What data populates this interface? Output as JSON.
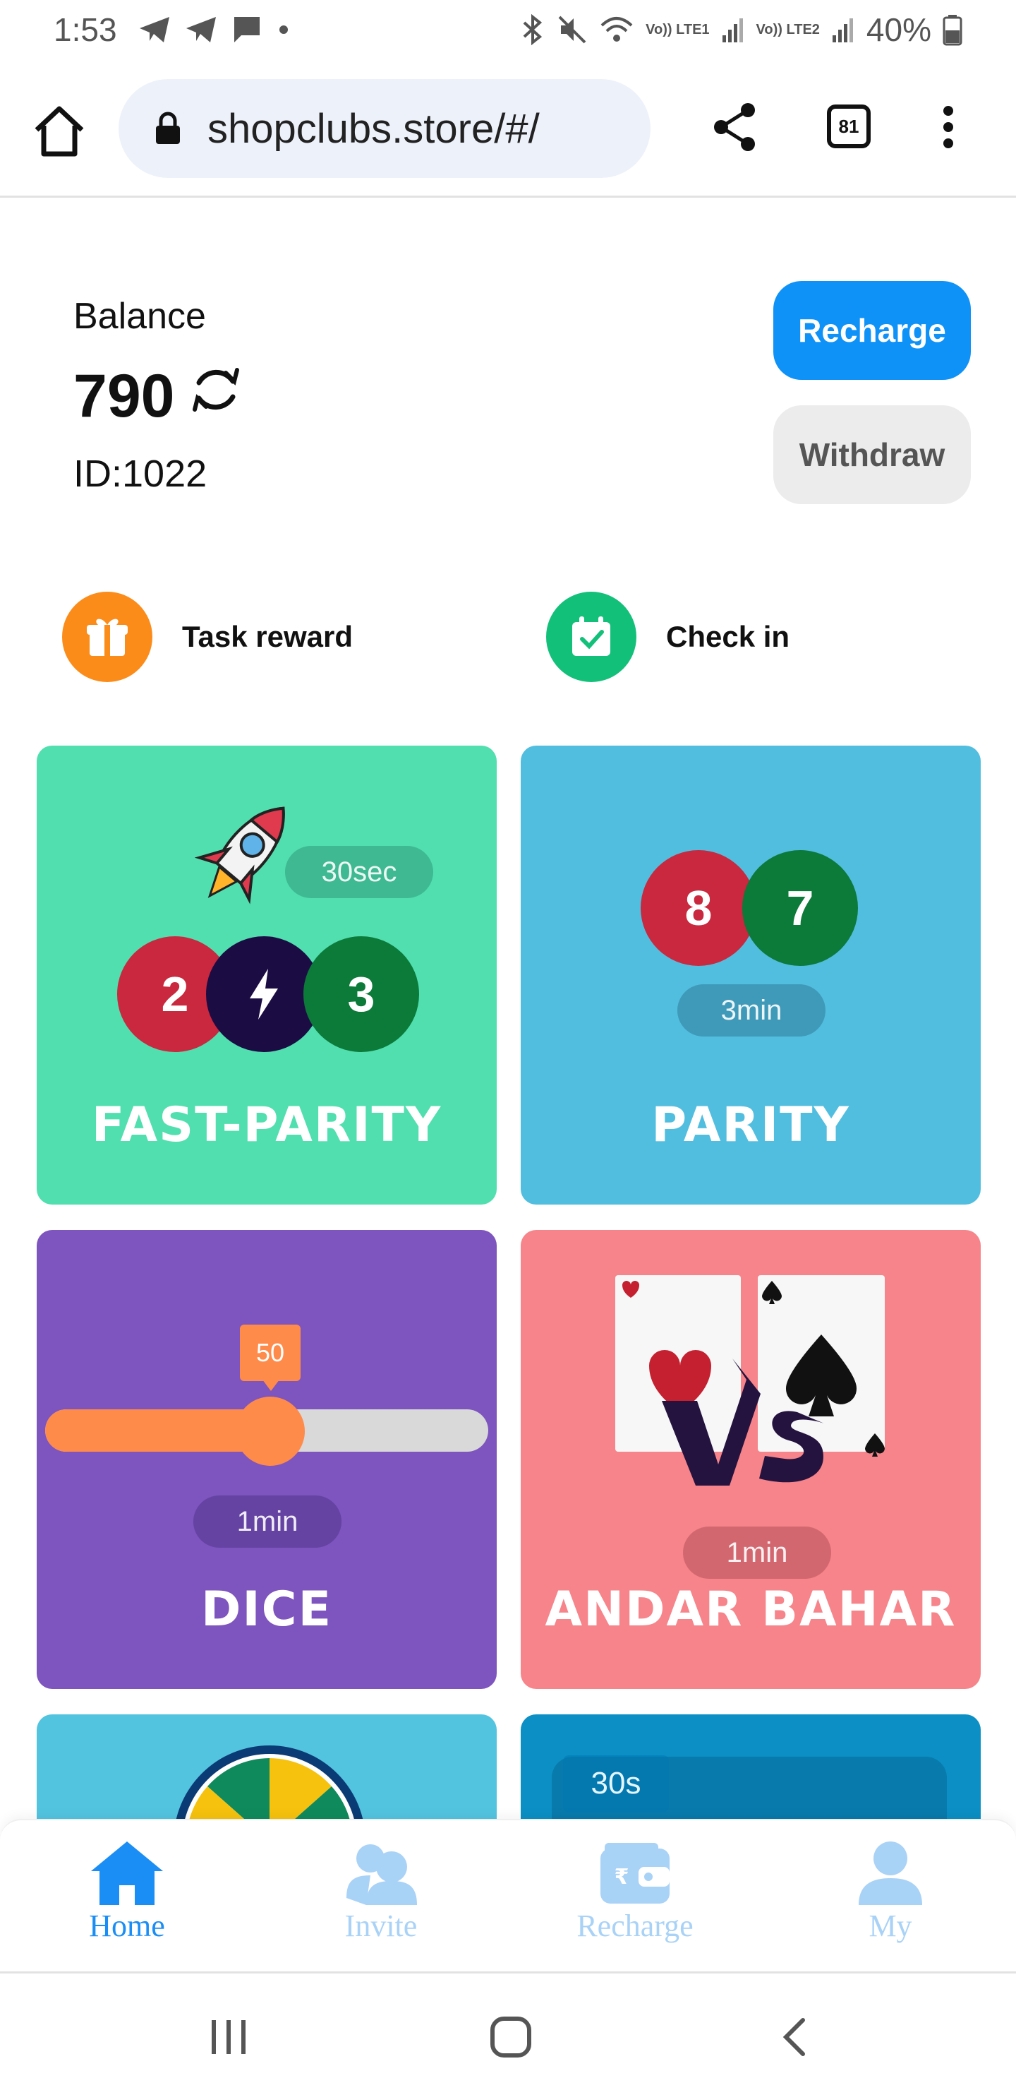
{
  "status_bar": {
    "time": "1:53",
    "network_1": "Vo)) LTE1",
    "network_2": "Vo)) LTE2",
    "battery": "40%"
  },
  "browser": {
    "url": "shopclubs.store/#/",
    "tab_count": "81"
  },
  "account": {
    "balance_label": "Balance",
    "balance_value": "790",
    "user_id": "ID:1022",
    "recharge_label": "Recharge",
    "withdraw_label": "Withdraw"
  },
  "quick_actions": {
    "task_reward": "Task reward",
    "check_in": "Check in"
  },
  "games": {
    "fast_parity": {
      "title": "FAST-PARITY",
      "timer": "30sec",
      "ball_left": "2",
      "ball_right": "3"
    },
    "parity": {
      "title": "PARITY",
      "timer": "3min",
      "ball_left": "8",
      "ball_right": "7"
    },
    "dice": {
      "title": "DICE",
      "timer": "1min",
      "slider_value": "50"
    },
    "andar_bahar": {
      "title": "ANDAR BAHAR",
      "timer": "1min"
    },
    "partial_card_timer": "30s"
  },
  "bottom_nav": {
    "home": "Home",
    "invite": "Invite",
    "recharge": "Recharge",
    "my": "My"
  },
  "colors": {
    "accent_blue": "#0f92f7",
    "fast_parity_bg": "#51dfb0",
    "parity_bg": "#52bedf",
    "dice_bg": "#7e54be",
    "andar_bahar_bg": "#f6848a"
  }
}
